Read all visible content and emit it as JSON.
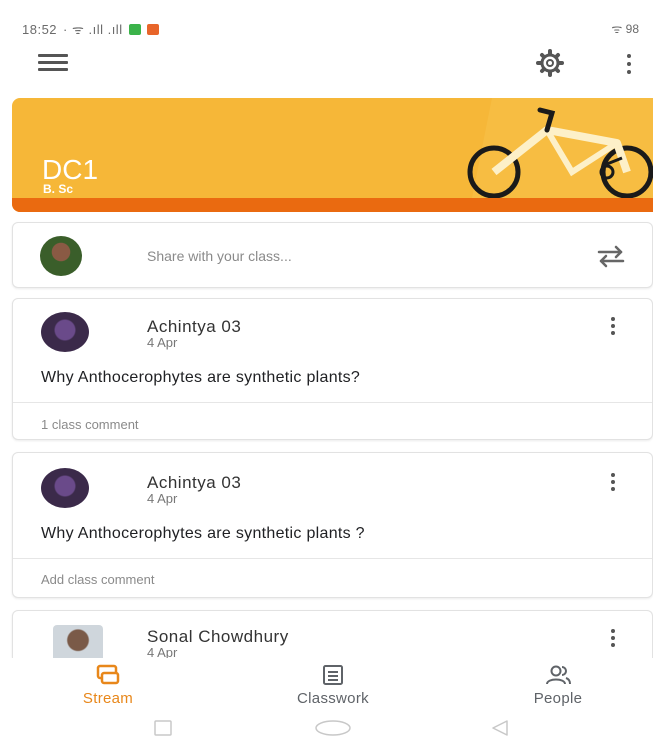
{
  "status": {
    "time": "18:52",
    "left_icons": "·  ᯤ .ıll .ıll ",
    "right": "ᯤ 98"
  },
  "header": {
    "menu_icon": "hamburger-icon",
    "settings_icon": "gear-icon",
    "more_icon": "more-vert-icon"
  },
  "banner": {
    "title": "DC1",
    "subtitle": "B. Sc",
    "bg_color": "#f6b738",
    "stripe_color": "#ea6a10"
  },
  "share": {
    "placeholder": "Share with your class..."
  },
  "posts": [
    {
      "author": "Achintya 03",
      "date": "4 Apr",
      "text": "Why Anthocerophytes are synthetic plants?",
      "footer": "1 class comment"
    },
    {
      "author": "Achintya 03",
      "date": "4 Apr",
      "text": "Why Anthocerophytes are synthetic plants ?",
      "footer": "Add class comment"
    },
    {
      "author": "Sonal Chowdhury",
      "date": "4 Apr"
    }
  ],
  "bottom_nav": {
    "items": [
      {
        "label": "Stream",
        "icon": "stream-icon",
        "active": true
      },
      {
        "label": "Classwork",
        "icon": "classwork-icon",
        "active": false
      },
      {
        "label": "People",
        "icon": "people-icon",
        "active": false
      }
    ],
    "active_color": "#e8871a",
    "inactive_color": "#5f6368"
  }
}
